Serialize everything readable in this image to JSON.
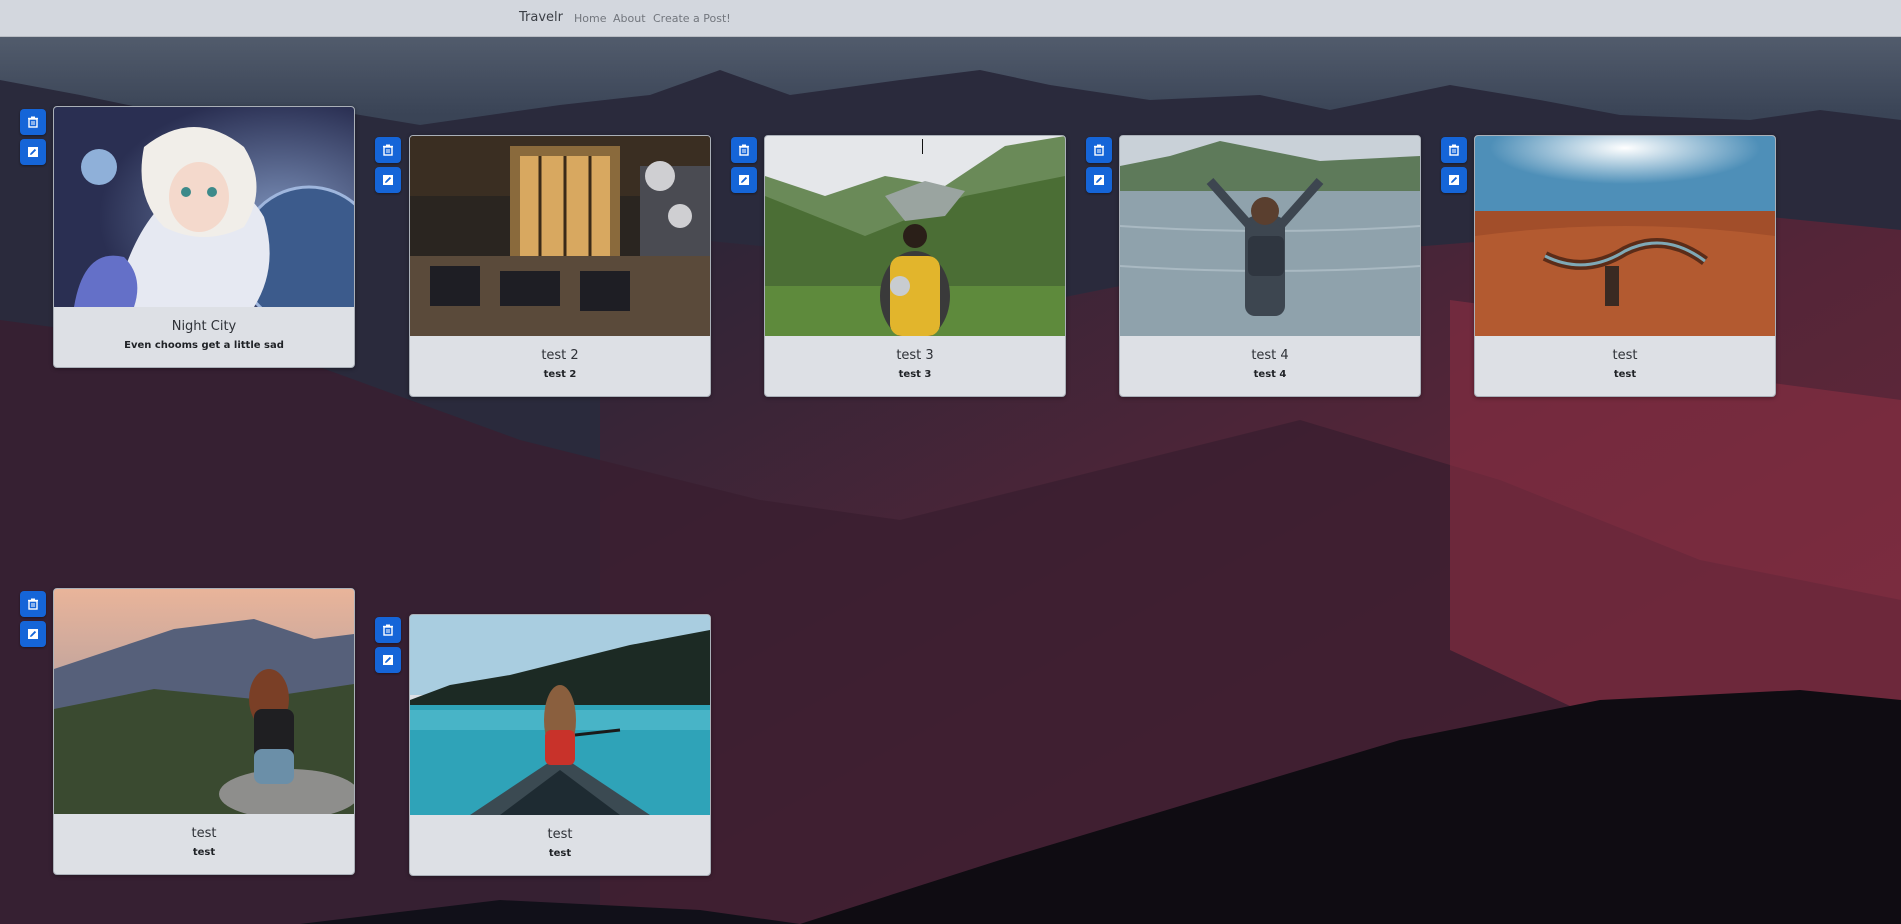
{
  "navbar": {
    "brand": "Travelr",
    "links": [
      {
        "label": "Home"
      },
      {
        "label": "About"
      },
      {
        "label": "Create a Post!"
      }
    ]
  },
  "posts": [
    {
      "title": "Night City",
      "text": "Even chooms get a little sad",
      "image_icon": "anime-astronaut-image"
    },
    {
      "title": "test 2",
      "text": "test 2",
      "image_icon": "restaurant-interior-image"
    },
    {
      "title": "test 3",
      "text": "test 3",
      "image_icon": "hiker-valley-image"
    },
    {
      "title": "test 4",
      "text": "test 4",
      "image_icon": "lake-cheer-image"
    },
    {
      "title": "test",
      "text": "test",
      "image_icon": "canyon-image"
    },
    {
      "title": "test",
      "text": "test",
      "image_icon": "mountain-sunset-image"
    },
    {
      "title": "test",
      "text": "test",
      "image_icon": "canoe-lake-image"
    }
  ],
  "actions": {
    "delete_icon": "trash-icon",
    "edit_icon": "edit-icon"
  },
  "colors": {
    "button": "#1565d8",
    "navbar": "#d3d7de",
    "card": "#dde0e5"
  }
}
